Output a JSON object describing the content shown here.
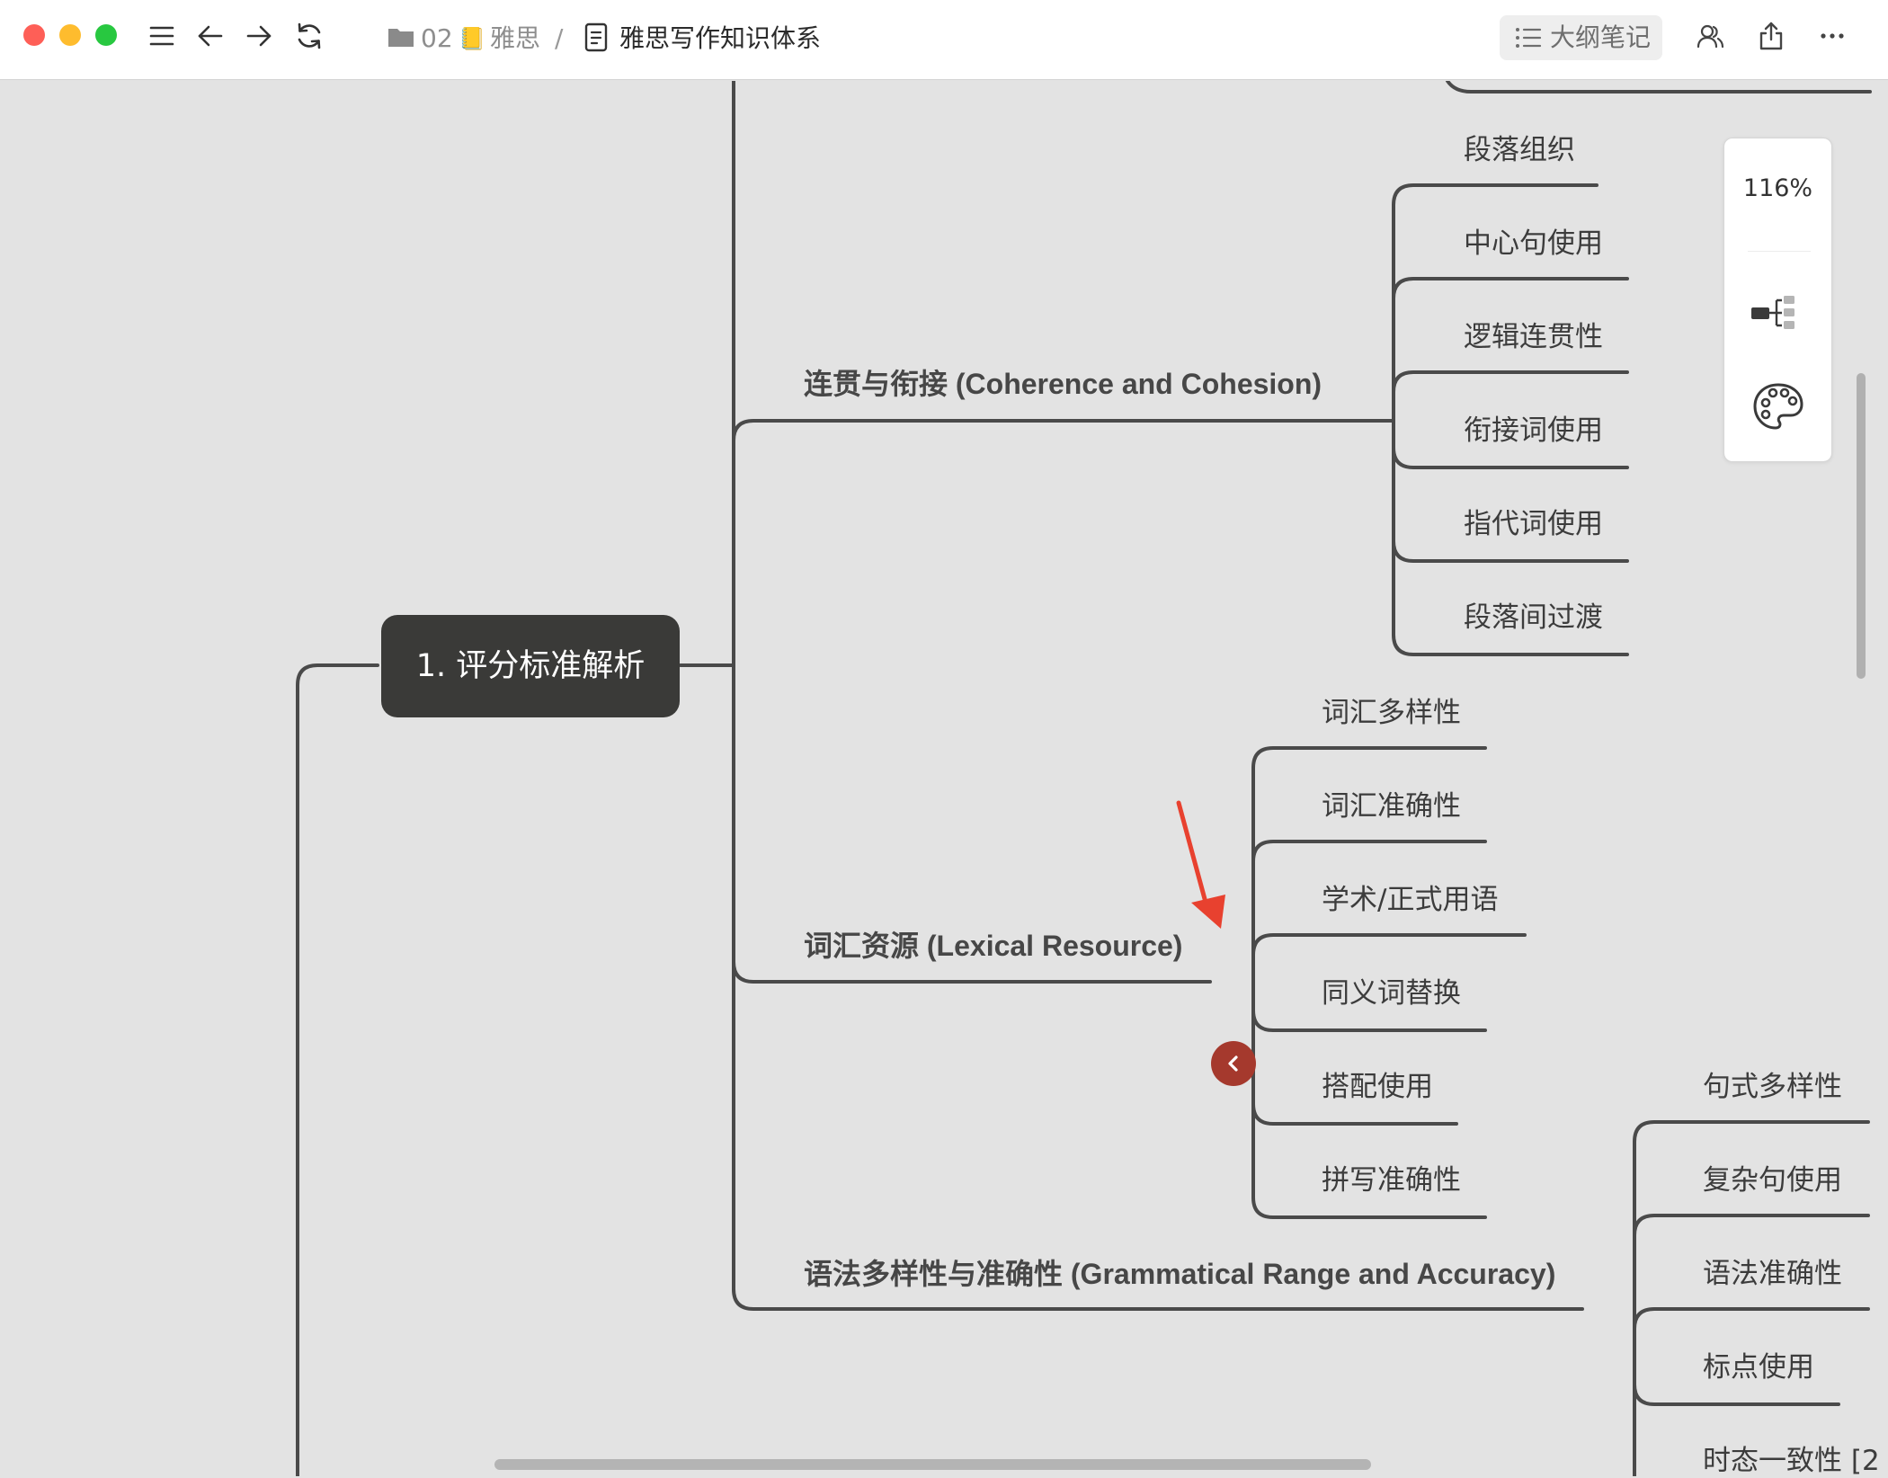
{
  "window": {
    "traffic_lights": [
      "close",
      "minimize",
      "zoom"
    ],
    "colors": {
      "close": "#fe5f57",
      "minimize": "#febc2e",
      "zoom": "#28c840"
    }
  },
  "toolbar": {
    "icons": [
      "menu-icon",
      "back-arrow-icon",
      "forward-arrow-icon",
      "refresh-icon"
    ]
  },
  "breadcrumb": {
    "folder_icon": "folder-icon",
    "folder_label": "02",
    "notebook_emoji": "📒",
    "notebook_label": "雅思",
    "separator": "/",
    "doc_icon": "document-icon",
    "doc_title": "雅思写作知识体系"
  },
  "header_right": {
    "outline_button_label": "大纲笔记",
    "icons": [
      "collaborate-icon",
      "share-icon",
      "more-icon"
    ]
  },
  "side_panel": {
    "zoom_label": "116%",
    "icons": [
      "structure-icon",
      "theme-palette-icon"
    ]
  },
  "mindmap": {
    "root": {
      "label": "1. 评分标准解析"
    },
    "branches": [
      {
        "label": "连贯与衔接 (Coherence and Cohesion)",
        "children": [
          "段落组织",
          "中心句使用",
          "逻辑连贯性",
          "衔接词使用",
          "指代词使用",
          "段落间过渡"
        ]
      },
      {
        "label": "词汇资源 (Lexical Resource)",
        "children": [
          "词汇多样性",
          "词汇准确性",
          "学术/正式用语",
          "同义词替换",
          "搭配使用",
          "拼写准确性"
        ]
      },
      {
        "label": "语法多样性与准确性 (Grammatical Range and Accuracy)",
        "children": [
          "句式多样性",
          "复杂句使用",
          "语法准确性",
          "标点使用",
          "时态一致性 [2"
        ]
      }
    ],
    "collapse_icon": "chevron-left-icon",
    "annotation": "red-arrow-pointer",
    "colors": {
      "line": "#4a4a4a",
      "root_fill": "#3a3a38",
      "collapse_button": "#a5392d",
      "annotation": "#e8412f"
    }
  }
}
